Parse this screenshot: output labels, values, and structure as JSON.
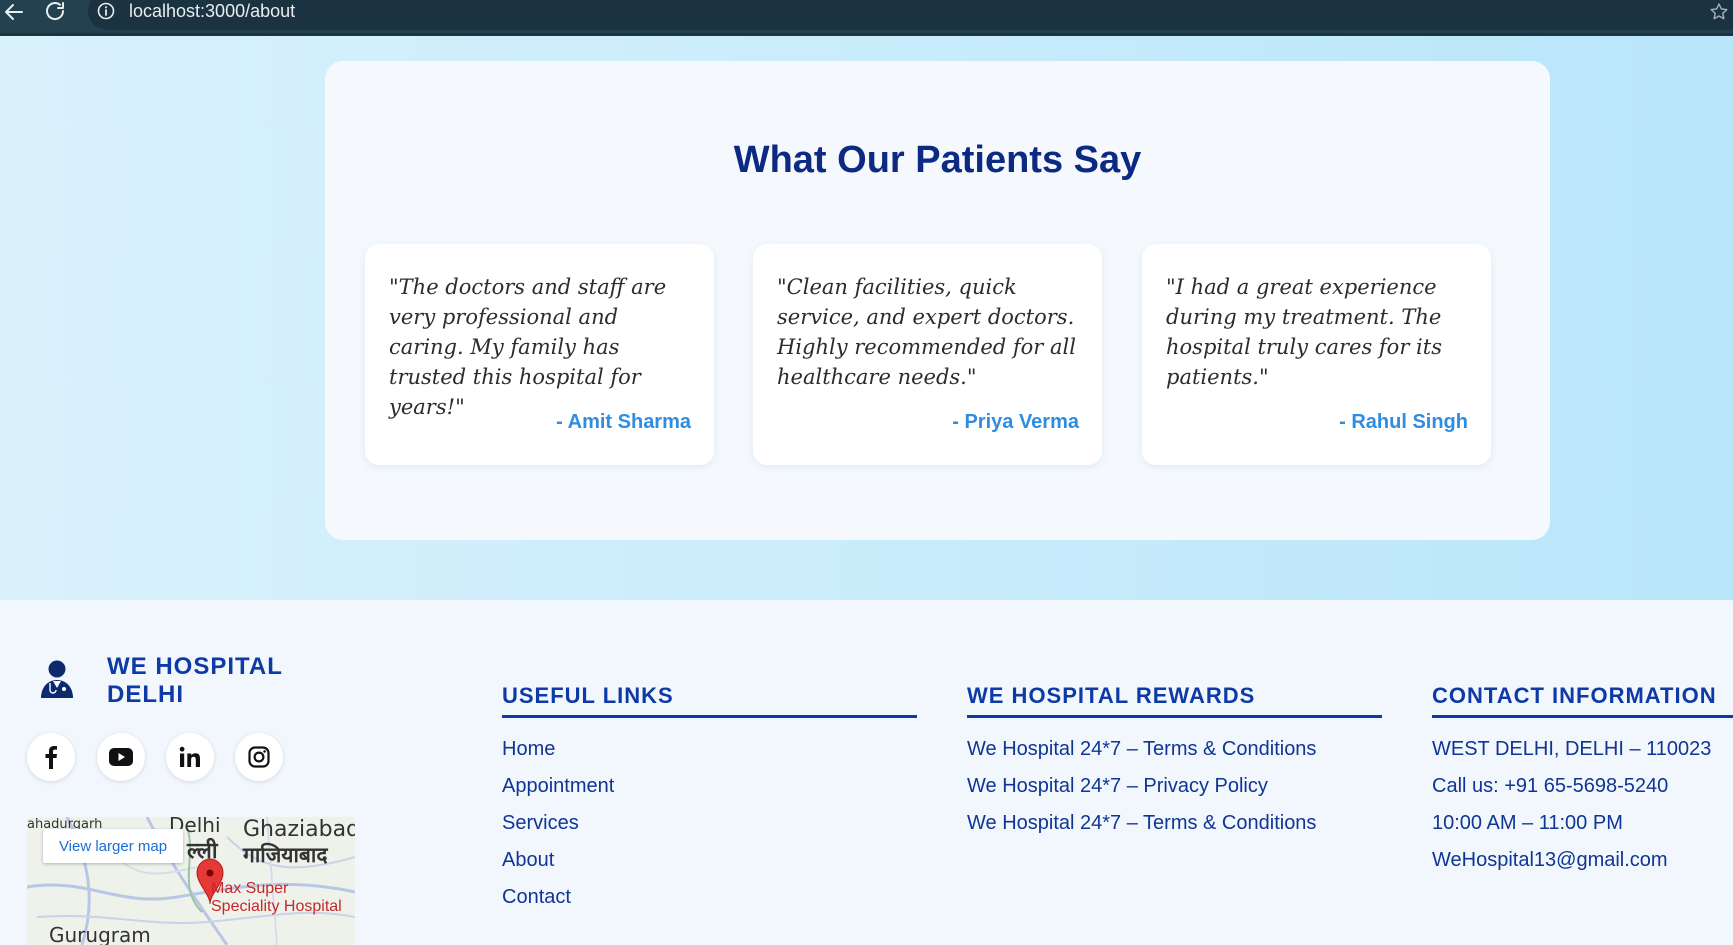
{
  "browser": {
    "url": "localhost:3000/about",
    "back_icon": "arrow-left-icon",
    "reload_icon": "reload-icon",
    "info_icon": "info-icon",
    "bookmark_icon": "star-icon"
  },
  "testimonials": {
    "title": "What Our Patients Say",
    "items": [
      {
        "quote": "\"The doctors and staff are very professional and caring. My family has trusted this hospital for years!\"",
        "author": "- Amit Sharma"
      },
      {
        "quote": "\"Clean facilities, quick service, and expert doctors. Highly recommended for all healthcare needs.\"",
        "author": "- Priya Verma"
      },
      {
        "quote": "\"I had a great experience during my treatment. The hospital truly cares for its patients.\"",
        "author": "- Rahul Singh"
      }
    ]
  },
  "footer": {
    "brand": "WE HOSPITAL DELHI",
    "brand_icon": "doctor-icon",
    "social": [
      "facebook-icon",
      "youtube-icon",
      "linkedin-icon",
      "instagram-icon"
    ],
    "map": {
      "link": "View larger map",
      "labels": [
        "ahadurgarh",
        "Delhi",
        "ल्ली",
        "Ghaziabad",
        "गाजियाबाद",
        "Gurugram"
      ],
      "pin_label_1": "Max Super",
      "pin_label_2": "Speciality Hospital"
    },
    "useful_links": {
      "title": "USEFUL LINKS",
      "items": [
        "Home",
        "Appointment",
        "Services",
        "About",
        "Contact"
      ]
    },
    "rewards": {
      "title": "WE HOSPITAL REWARDS",
      "items": [
        "We Hospital 24*7 – Terms & Conditions",
        "We Hospital 24*7 – Privacy Policy",
        "We Hospital 24*7 – Terms & Conditions"
      ]
    },
    "contact": {
      "title": "CONTACT INFORMATION",
      "items": [
        "WEST DELHI, DELHI – 110023",
        "Call us: +91 65-5698-5240",
        "10:00 AM – 11:00 PM",
        "WeHospital13@gmail.com"
      ]
    }
  },
  "colors": {
    "heading": "#0d2a82",
    "author": "#2f8de0",
    "footer_text": "#0f3595"
  }
}
